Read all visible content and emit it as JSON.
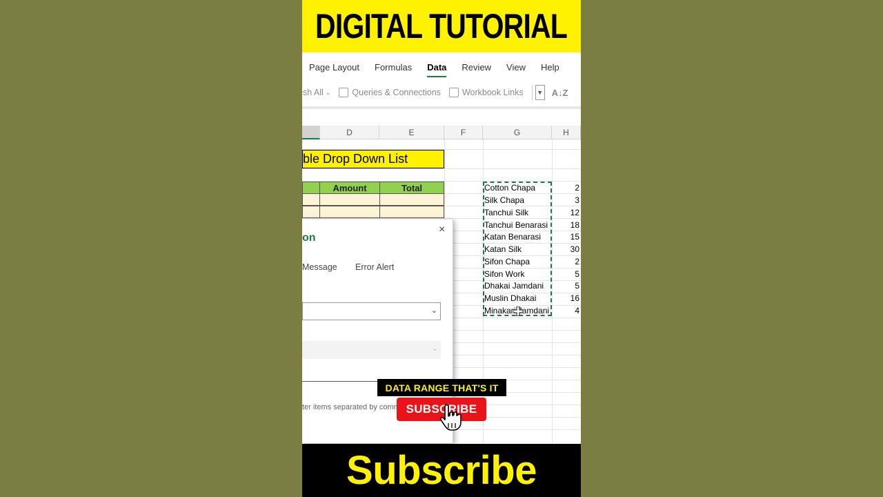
{
  "top_banner": {
    "text": "DIGITAL TUTORIAL"
  },
  "ribbon": {
    "tabs": [
      {
        "label": "Page Layout",
        "active": false
      },
      {
        "label": "Formulas",
        "active": false
      },
      {
        "label": "Data",
        "active": true
      },
      {
        "label": "Review",
        "active": false
      },
      {
        "label": "View",
        "active": false
      },
      {
        "label": "Help",
        "active": false
      }
    ],
    "tools": {
      "refresh_all": "esh All",
      "queries": "Queries & Connections",
      "workbook_links": "Workbook Links",
      "sort_az": "A↓Z"
    }
  },
  "sheet": {
    "columns": [
      "D",
      "E",
      "F",
      "G",
      "H"
    ],
    "title_cell": "ble Drop Down List",
    "table_headers": {
      "amount": "Amount",
      "total": "Total"
    },
    "product_list": [
      "Cotton Chapa",
      "Silk Chapa",
      "Tanchui Silk",
      "Tanchui Benarasi",
      "Katan Benarasi",
      "Katan Silk",
      "Sifon Chapa",
      "Sifon Work",
      "Dhakai Jamdani",
      "Muslin Dhakai",
      "Minakari Jamdani"
    ],
    "h_values": [
      "2",
      "3",
      "12",
      "18",
      "15",
      "30",
      "2",
      "5",
      "5",
      "16",
      "4"
    ]
  },
  "dialog": {
    "title": "on",
    "close_glyph": "×",
    "tabs": {
      "input_message": "Message",
      "error_alert": "Error Alert"
    },
    "hint": "ter items separated by comm"
  },
  "overlays": {
    "caption": "DATA RANGE THAT'S IT",
    "subscribe_button": "SUBSCRIBE",
    "bottom_banner": "Subscribe"
  },
  "colors": {
    "banner_yellow": "#fff200",
    "excel_green": "#1d7a44",
    "header_green": "#92d050",
    "subscribe_red": "#e8141a"
  }
}
